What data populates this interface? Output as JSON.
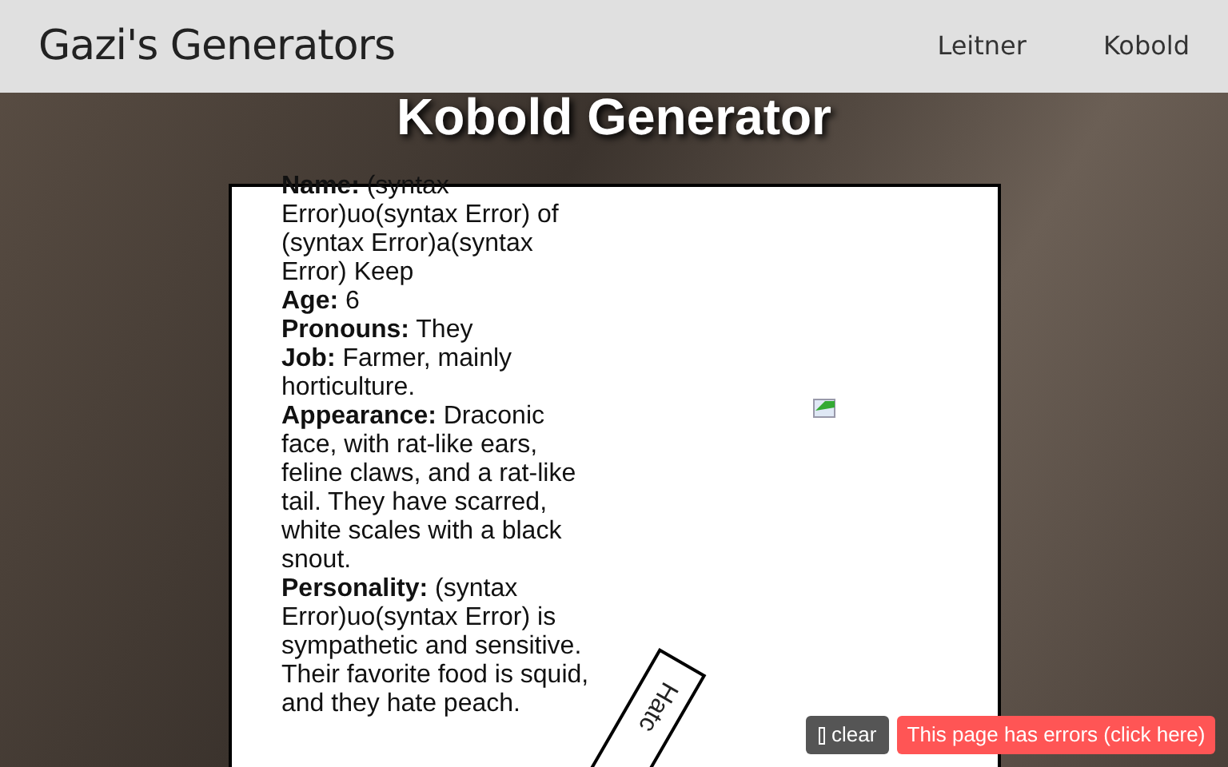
{
  "header": {
    "title": "Gazi's Generators",
    "nav": [
      "Leitner",
      "Kobold"
    ]
  },
  "heading": "Kobold Generator",
  "entries": [
    "**Name:** (syntax Error)uo(syntax Error) of (syntax Error)a(syntax Error) Keep",
    "**Age:** 6",
    "**Pronouns:** They",
    "**Job:** Farmer, mainly horticulture.",
    "**Appearance:** Draconic face, with rat-like ears, feline claws, and a rat-like tail. They have scarred, white scales with a black snout.",
    "**Personality:** (syntax Error)uo(syntax Error) is sympathetic and sensitive. Their favorite food is squid, and they hate peach."
  ],
  "rotated_tag": "Hatc",
  "clear_button": "clear",
  "error_button": "This page has errors (click here)"
}
